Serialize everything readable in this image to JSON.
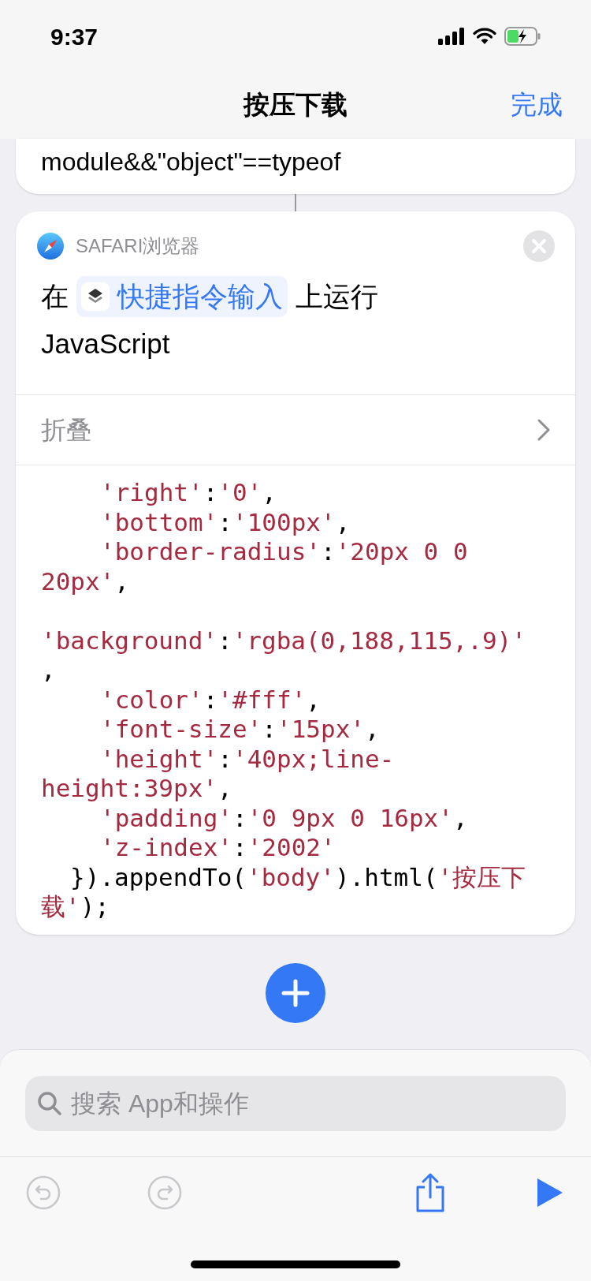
{
  "status_bar": {
    "time": "9:37"
  },
  "nav": {
    "title": "按压下载",
    "done": "完成"
  },
  "previous_card": {
    "lines": [
      "module&&\"object\"==typeof"
    ]
  },
  "action_card": {
    "app": "SAFARI浏览器",
    "prefix": "在",
    "variable": "快捷指令输入",
    "suffix": "上运行",
    "title_line2": "JavaScript",
    "collapse": "折叠",
    "code": [
      {
        "kind": "deep",
        "segments": [
          {
            "kind": "str",
            "text": "'right'"
          },
          {
            "kind": "plain",
            "text": ":"
          },
          {
            "kind": "str",
            "text": "'0'"
          },
          {
            "kind": "plain",
            "text": ","
          }
        ]
      },
      {
        "kind": "deep",
        "segments": [
          {
            "kind": "str",
            "text": "'bottom'"
          },
          {
            "kind": "plain",
            "text": ":"
          },
          {
            "kind": "str",
            "text": "'100px'"
          },
          {
            "kind": "plain",
            "text": ","
          }
        ]
      },
      {
        "kind": "deep",
        "segments": [
          {
            "kind": "str",
            "text": "'border-radius'"
          },
          {
            "kind": "plain",
            "text": ":"
          },
          {
            "kind": "str",
            "text": "'20px 0 0"
          }
        ]
      },
      {
        "kind": "flush",
        "segments": [
          {
            "kind": "str",
            "text": "20px'"
          },
          {
            "kind": "plain",
            "text": ","
          }
        ]
      },
      {
        "kind": "blank"
      },
      {
        "kind": "flush",
        "segments": [
          {
            "kind": "str",
            "text": "'background'"
          },
          {
            "kind": "plain",
            "text": ":"
          },
          {
            "kind": "str",
            "text": "'rgba(0,188,115,.9)'"
          }
        ]
      },
      {
        "kind": "flush",
        "segments": [
          {
            "kind": "plain",
            "text": ","
          }
        ]
      },
      {
        "kind": "deep",
        "segments": [
          {
            "kind": "str",
            "text": "'color'"
          },
          {
            "kind": "plain",
            "text": ":"
          },
          {
            "kind": "str",
            "text": "'#fff'"
          },
          {
            "kind": "plain",
            "text": ","
          }
        ]
      },
      {
        "kind": "deep",
        "segments": [
          {
            "kind": "str",
            "text": "'font-size'"
          },
          {
            "kind": "plain",
            "text": ":"
          },
          {
            "kind": "str",
            "text": "'15px'"
          },
          {
            "kind": "plain",
            "text": ","
          }
        ]
      },
      {
        "kind": "deep",
        "segments": [
          {
            "kind": "str",
            "text": "'height'"
          },
          {
            "kind": "plain",
            "text": ":"
          },
          {
            "kind": "str",
            "text": "'40px;line-"
          }
        ]
      },
      {
        "kind": "flush",
        "segments": [
          {
            "kind": "str",
            "text": "height:39px'"
          },
          {
            "kind": "plain",
            "text": ","
          }
        ]
      },
      {
        "kind": "deep",
        "segments": [
          {
            "kind": "str",
            "text": "'padding'"
          },
          {
            "kind": "plain",
            "text": ":"
          },
          {
            "kind": "str",
            "text": "'0 9px 0 16px'"
          },
          {
            "kind": "plain",
            "text": ","
          }
        ]
      },
      {
        "kind": "deep",
        "segments": [
          {
            "kind": "str",
            "text": "'z-index'"
          },
          {
            "kind": "plain",
            "text": ":"
          },
          {
            "kind": "str",
            "text": "'2002'"
          }
        ]
      },
      {
        "kind": "shallow",
        "segments": [
          {
            "kind": "plain",
            "text": "}).appendTo("
          },
          {
            "kind": "str",
            "text": "'body'"
          },
          {
            "kind": "plain",
            "text": ").html("
          },
          {
            "kind": "str",
            "text": "'按压下"
          }
        ]
      },
      {
        "kind": "flush",
        "segments": [
          {
            "kind": "str",
            "text": "载'"
          },
          {
            "kind": "plain",
            "text": ");"
          }
        ]
      }
    ]
  },
  "search": {
    "placeholder": "搜索 App和操作"
  }
}
